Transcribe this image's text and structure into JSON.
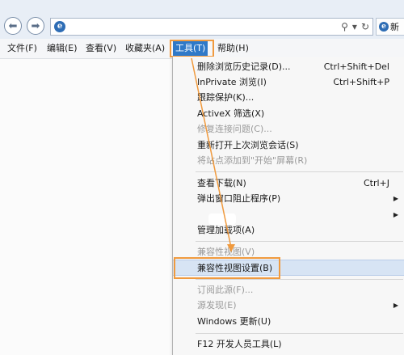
{
  "window": {
    "tab_title": "新",
    "address_tools": {
      "search": "⚲",
      "dropdown": "▾",
      "refresh": "↻"
    }
  },
  "menubar": {
    "file": "文件(F)",
    "edit": "编辑(E)",
    "view": "查看(V)",
    "favorites": "收藏夹(A)",
    "tools": "工具(T)",
    "help": "帮助(H)"
  },
  "tools_menu": {
    "items": [
      {
        "label": "删除浏览历史记录(D)...",
        "shortcut": "Ctrl+Shift+Del"
      },
      {
        "label": "InPrivate 浏览(I)",
        "shortcut": "Ctrl+Shift+P"
      },
      {
        "label": "跟踪保护(K)..."
      },
      {
        "label": "ActiveX 筛选(X)"
      },
      {
        "label": "修复连接问题(C)...",
        "disabled": true
      },
      {
        "label": "重新打开上次浏览会话(S)"
      },
      {
        "label": "将站点添加到\"开始\"屏幕(R)",
        "disabled": true
      },
      {
        "label": "查看下载(N)",
        "shortcut": "Ctrl+J"
      },
      {
        "label": "弹出窗口阻止程序(P)",
        "submenu": true
      },
      {
        "label": "",
        "submenu": true
      },
      {
        "label": "管理加载项(A)"
      },
      {
        "label": "兼容性视图(V)",
        "disabled": true
      },
      {
        "label": "兼容性视图设置(B)",
        "selected": true
      },
      {
        "label": "订阅此源(F)...",
        "disabled": true
      },
      {
        "label": "源发现(E)",
        "disabled": true,
        "submenu": true
      },
      {
        "label": "Windows 更新(U)"
      },
      {
        "label": "F12 开发人员工具(L)"
      }
    ]
  },
  "colors": {
    "accent_highlight": "#f09a3e",
    "active_menu": "#2f79c8"
  }
}
